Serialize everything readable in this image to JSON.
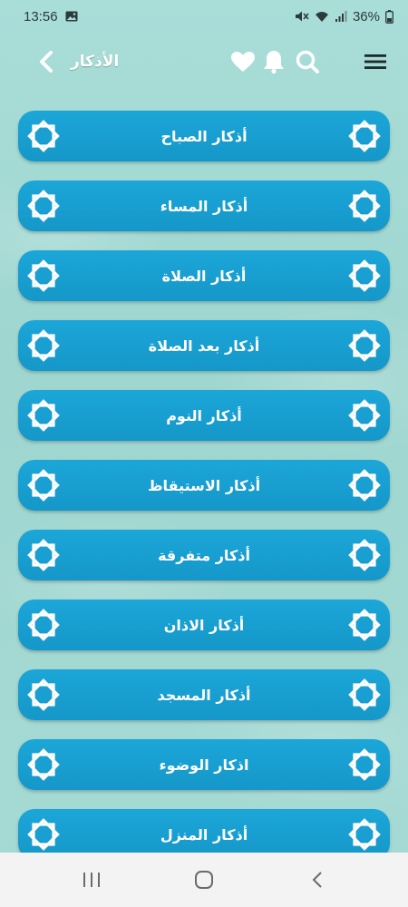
{
  "status": {
    "time": "13:56",
    "battery": "36%"
  },
  "header": {
    "title": "الأذكار",
    "icons": {
      "menu": "hamburger-menu-icon",
      "search": "search-icon",
      "notifications": "bell-icon",
      "favorites": "heart-icon",
      "back": "chevron-left-icon"
    }
  },
  "items": [
    {
      "label": "أذكار الصباح"
    },
    {
      "label": "أذكار المساء"
    },
    {
      "label": "أذكار  الصلاة"
    },
    {
      "label": "أذكار بعد الصلاة"
    },
    {
      "label": "أذكار النوم"
    },
    {
      "label": "أذكار الاستيقاظ"
    },
    {
      "label": "أذكار متفرقة"
    },
    {
      "label": "أذكار الاذان"
    },
    {
      "label": "أذكار المسجد"
    },
    {
      "label": "اذكار الوضوء"
    },
    {
      "label": "أذكار المنزل"
    }
  ],
  "colors": {
    "background": "#a3d9d3",
    "item": "#1a9fd2",
    "text": "#ffffff"
  }
}
